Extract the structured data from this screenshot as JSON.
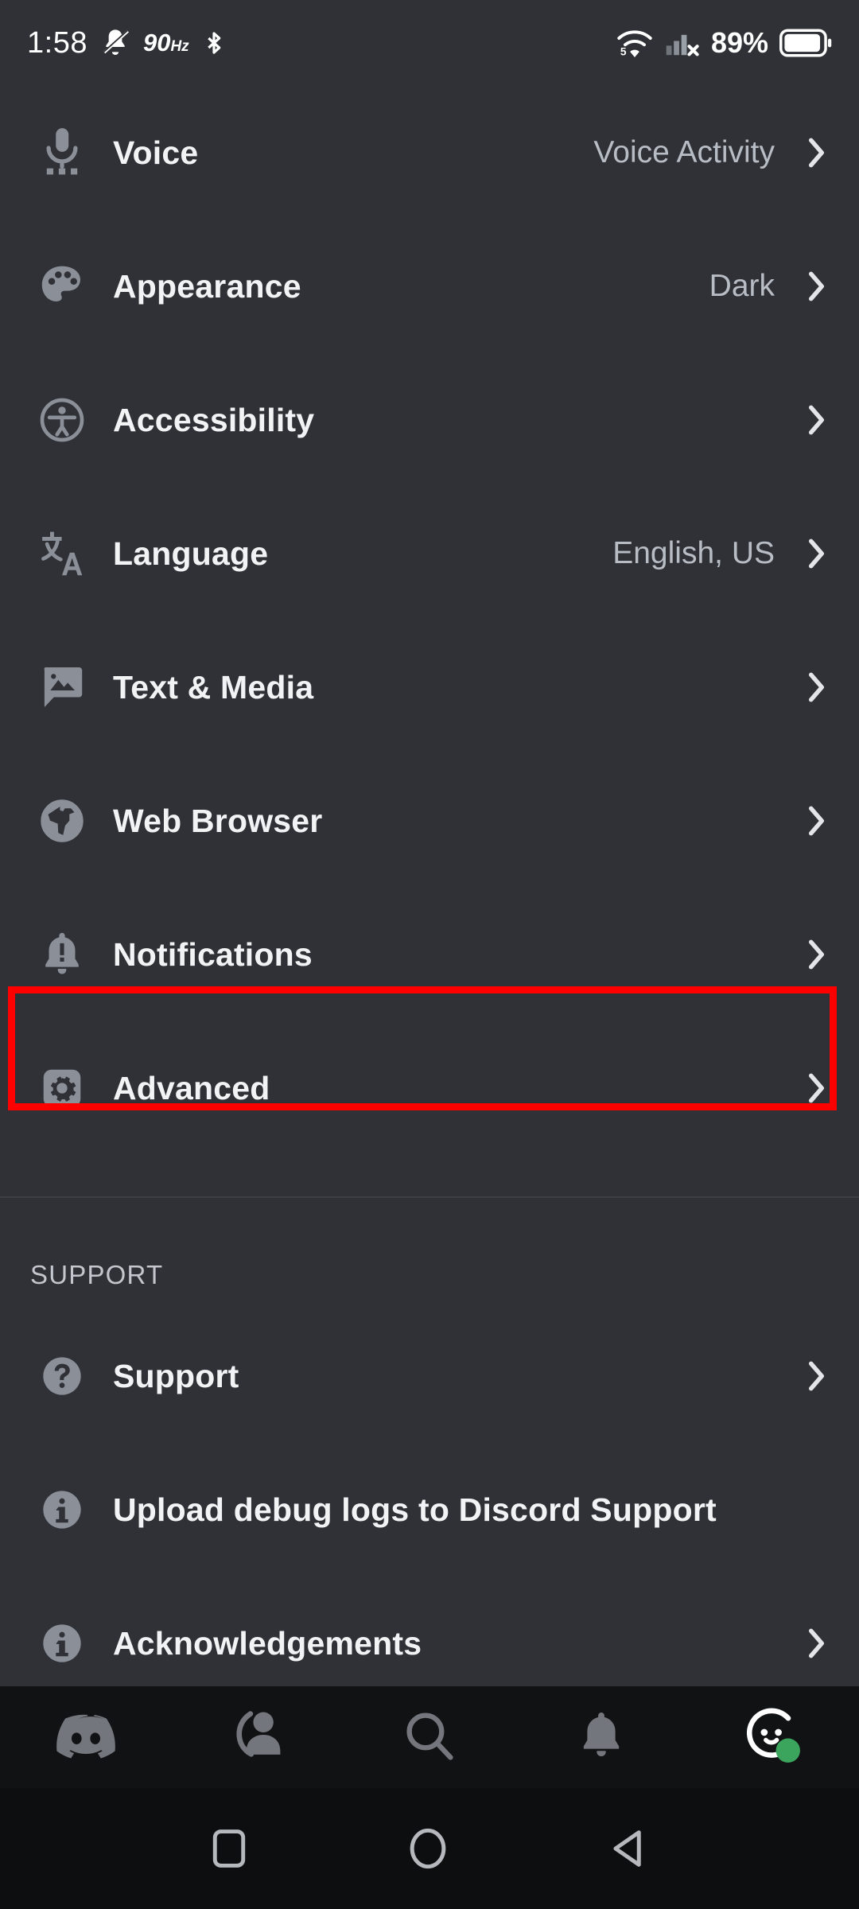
{
  "status_bar": {
    "clock": "1:58",
    "icons_left": [
      "bell-muted-icon",
      "bluetooth-icon"
    ],
    "refresh_rate": "90",
    "refresh_rate_unit": "Hz",
    "wifi_level_badge": "5",
    "signal_state": "no-service",
    "battery_percent": "89%",
    "colors": {
      "text": "#ffffff",
      "background": "#2f3136"
    }
  },
  "settings": {
    "rows": [
      {
        "label": "Voice",
        "value": "Voice Activity",
        "icon": "microphone-icon",
        "chevron": true
      },
      {
        "label": "Appearance",
        "value": "Dark",
        "icon": "palette-icon",
        "chevron": true
      },
      {
        "label": "Accessibility",
        "value": "",
        "icon": "accessibility-icon",
        "chevron": true
      },
      {
        "label": "Language",
        "value": "English, US",
        "icon": "translate-icon",
        "chevron": true
      },
      {
        "label": "Text & Media",
        "value": "",
        "icon": "image-message-icon",
        "chevron": true
      },
      {
        "label": "Web Browser",
        "value": "",
        "icon": "globe-icon",
        "chevron": true
      },
      {
        "label": "Notifications",
        "value": "",
        "icon": "bell-alert-icon",
        "chevron": true
      },
      {
        "label": "Advanced",
        "value": "",
        "icon": "gear-icon",
        "chevron": true
      }
    ],
    "support_section": {
      "header": "SUPPORT",
      "rows": [
        {
          "label": "Support",
          "value": "",
          "icon": "question-circle-icon",
          "chevron": true
        },
        {
          "label": "Upload debug logs to Discord Support",
          "value": "",
          "icon": "info-circle-icon",
          "chevron": false
        },
        {
          "label": "Acknowledgements",
          "value": "",
          "icon": "info-circle-icon",
          "chevron": true
        }
      ]
    }
  },
  "highlight": {
    "target_row_label": "Advanced",
    "color": "#ff0000"
  },
  "bottom_nav": {
    "items": [
      {
        "name": "discord-home-icon",
        "active": false
      },
      {
        "name": "friends-icon",
        "active": false
      },
      {
        "name": "search-icon",
        "active": false
      },
      {
        "name": "notifications-icon",
        "active": false
      },
      {
        "name": "profile-avatar-icon",
        "active": true,
        "status": "online",
        "status_color": "#3ba55d"
      }
    ]
  },
  "system_nav": {
    "buttons": [
      "recents-square-icon",
      "home-circle-icon",
      "back-triangle-icon"
    ]
  },
  "theme": {
    "background": "#2f3136",
    "nav_background": "#111214",
    "text_primary": "#f2f3f5",
    "text_secondary": "#b8bcc4",
    "icon_gray": "#8a8f98"
  }
}
